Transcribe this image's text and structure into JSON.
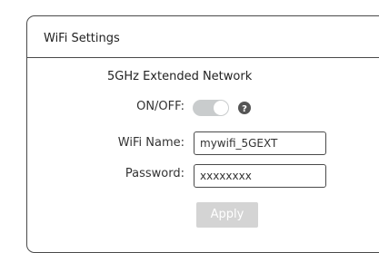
{
  "panel": {
    "title": "WiFi Settings"
  },
  "section": {
    "title": "5GHz Extended Network"
  },
  "onoff": {
    "label": "ON/OFF:",
    "state": "on",
    "help_icon": "question-circle-icon"
  },
  "wifi_name": {
    "label": "WiFi Name:",
    "value": "mywifi_5GEXT"
  },
  "password": {
    "label": "Password:",
    "value": "xxxxxxxx"
  },
  "apply": {
    "label": "Apply",
    "enabled": false
  },
  "colors": {
    "border": "#4a4a4a",
    "toggle_track": "#c9cccd",
    "button_disabled": "#d4d4d4",
    "help_icon": "#555555"
  }
}
